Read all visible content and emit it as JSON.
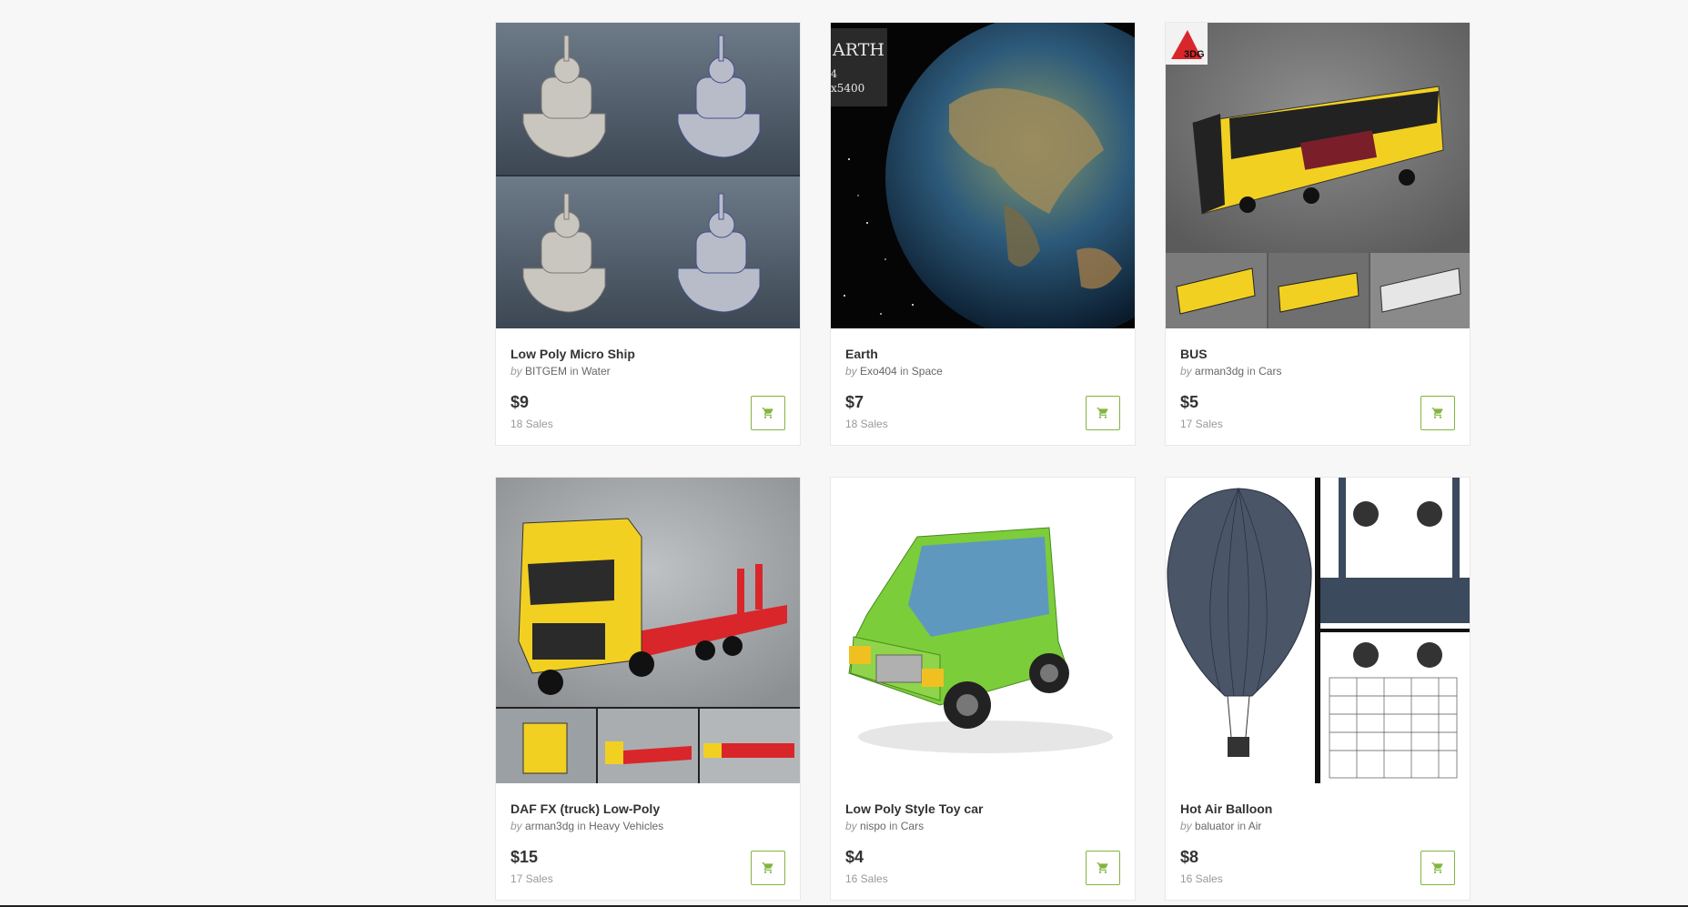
{
  "items": [
    {
      "title": "Low Poly Micro Ship",
      "by": "by",
      "author": "BITGEM",
      "in": "in",
      "category": "Water",
      "price": "$9",
      "sales": "18 Sales"
    },
    {
      "title": "Earth",
      "by": "by",
      "author": "Exo404",
      "in": "in",
      "category": "Space",
      "price": "$7",
      "sales": "18 Sales",
      "overlay_lines": [
        "ARTH",
        "4",
        "x5400"
      ]
    },
    {
      "title": "BUS",
      "by": "by",
      "author": "arman3dg",
      "in": "in",
      "category": "Cars",
      "price": "$5",
      "sales": "17 Sales",
      "logo_text": "3DG"
    },
    {
      "title": "DAF FX (truck) Low-Poly",
      "by": "by",
      "author": "arman3dg",
      "in": "in",
      "category": "Heavy Vehicles",
      "price": "$15",
      "sales": "17 Sales"
    },
    {
      "title": "Low Poly Style Toy car",
      "by": "by",
      "author": "nispo",
      "in": "in",
      "category": "Cars",
      "price": "$4",
      "sales": "16 Sales"
    },
    {
      "title": "Hot Air Balloon",
      "by": "by",
      "author": "baluator",
      "in": "in",
      "category": "Air",
      "price": "$8",
      "sales": "16 Sales"
    }
  ],
  "colors": {
    "accent": "#82b541",
    "bus_yellow": "#f2d022",
    "truck_red": "#d9262a",
    "car_green": "#7ccd3a",
    "balloon_blue": "#4a5568"
  }
}
